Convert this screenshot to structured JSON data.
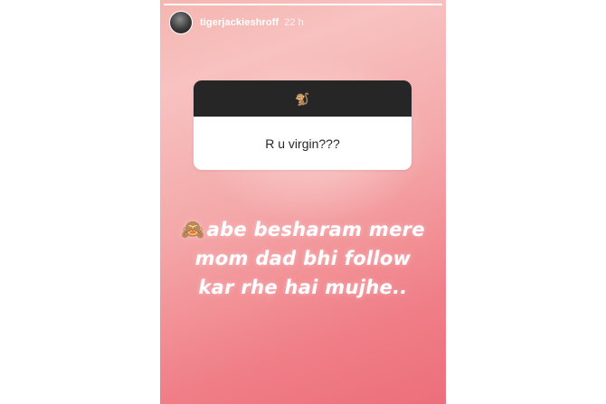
{
  "story": {
    "progress_fraction": 1.0,
    "header": {
      "username": "tigerjackieshroff",
      "time": "22 h"
    },
    "question_card": {
      "sticker": "🐒",
      "question": "R u virgin???"
    },
    "reply": {
      "emoji": "🙈",
      "line1": "abe besharam mere",
      "line2": "mom dad bhi follow",
      "line3": "kar rhe hai mujhe.."
    }
  },
  "colors": {
    "gradient_top": "#f5b5b0",
    "gradient_bottom": "#ec6f7b",
    "card_header": "#262626",
    "text_white": "#ffffff"
  }
}
